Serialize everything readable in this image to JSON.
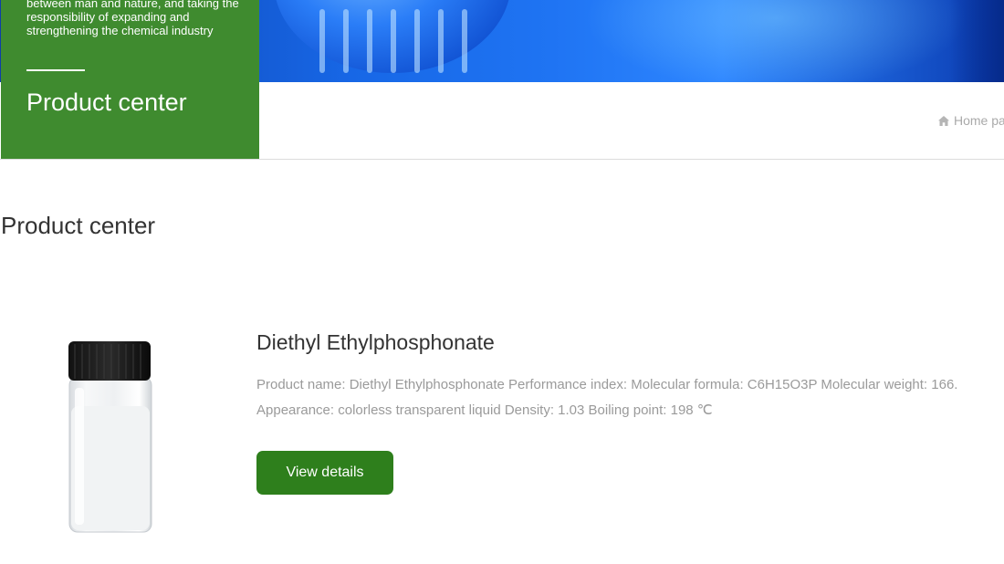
{
  "hero": {
    "slogan": "between man and nature, and taking the responsibility of expanding and strengthening the chemical industry",
    "section_title": "Product center"
  },
  "breadcrumb": {
    "home_label": "Home pa",
    "icon": "home-icon"
  },
  "page": {
    "heading": "Product center"
  },
  "product": {
    "name": "Diethyl Ethylphosphonate",
    "description_line1": "Product name: Diethyl Ethylphosphonate Performance index: Molecular formula: C6H15O3P Molecular weight: 166.",
    "description_line2": "Appearance: colorless transparent liquid Density: 1.03 Boiling point: 198 ℃",
    "button_label": "View details"
  },
  "colors": {
    "brand_green": "#3f8b2f",
    "button_green": "#2e7f1c",
    "banner_blue": "#1f74f3"
  }
}
